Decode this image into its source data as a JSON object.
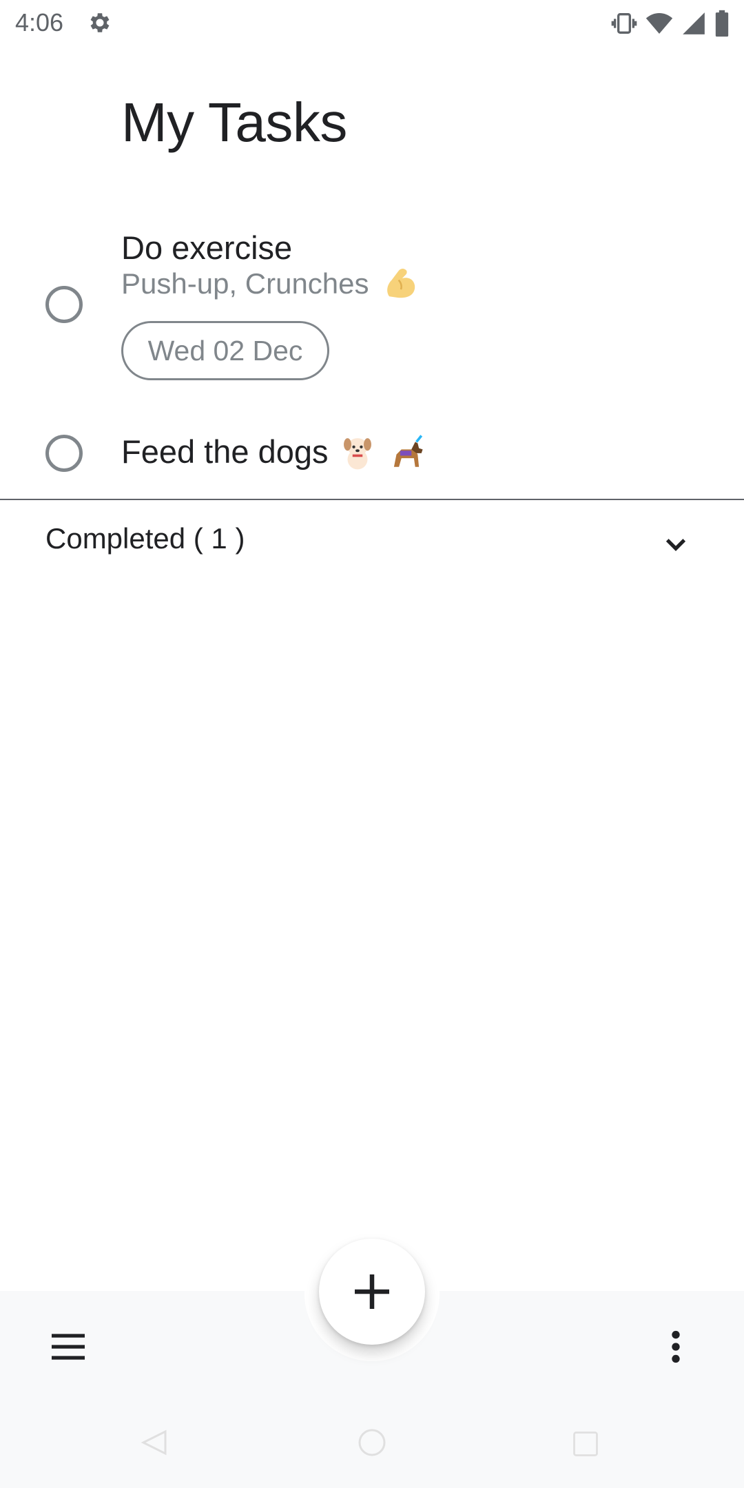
{
  "status_bar": {
    "time": "4:06",
    "icons": [
      "gear-icon",
      "vibrate-icon",
      "wifi-icon",
      "cell-signal-icon",
      "battery-icon"
    ]
  },
  "page": {
    "title": "My Tasks"
  },
  "tasks": [
    {
      "title": "Do exercise",
      "notes": "Push-up, Crunches",
      "notes_emoji": "flexed-biceps",
      "due_date": "Wed 02 Dec",
      "completed": false
    },
    {
      "title": "Feed the dogs",
      "title_emoji": [
        "dog",
        "service-dog"
      ],
      "completed": false
    }
  ],
  "completed_section": {
    "label": "Completed ( 1 )",
    "expanded": false
  },
  "bottom_bar": {
    "left_icon": "menu-icon",
    "fab_icon": "plus-icon",
    "right_icon": "more-vert-icon"
  },
  "colors": {
    "background": "#ffffff",
    "text_primary": "#202124",
    "text_secondary": "#80868b",
    "bottom_bar": "#f8f9fa"
  }
}
